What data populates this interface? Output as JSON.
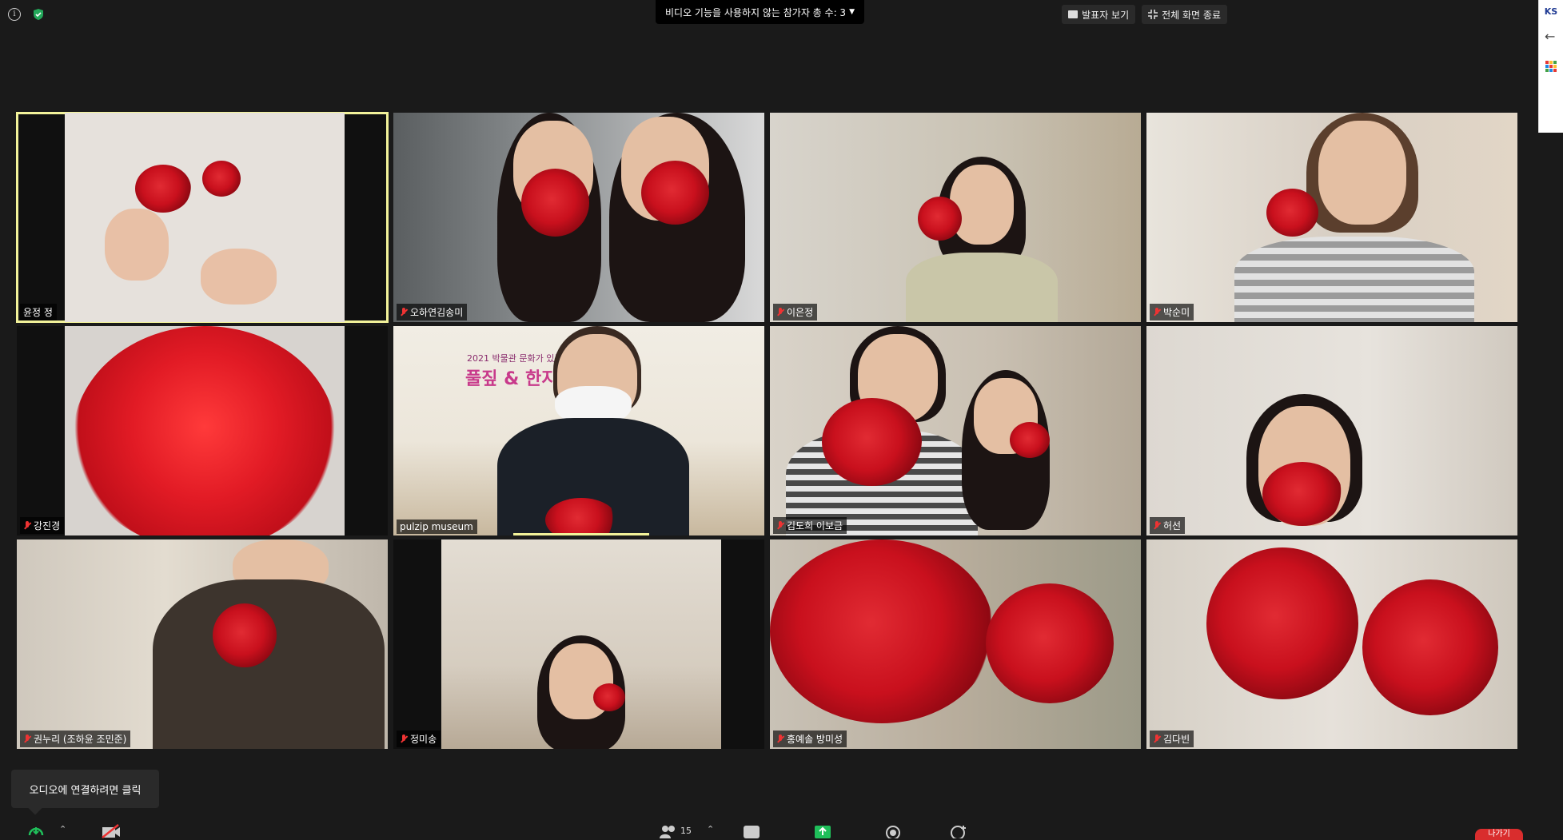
{
  "top_bar": {
    "participant_notice": "비디오 기능을 사용하지 않는 참가자 총 수: 3",
    "speaker_view_label": "발표자 보기",
    "exit_fullscreen_label": "전체 화면 종료"
  },
  "side_panel": {
    "logo_text": "KS"
  },
  "tiles": [
    {
      "name": "윤정 정",
      "muted": false,
      "active": true
    },
    {
      "name": "오하연김송미",
      "muted": true
    },
    {
      "name": "이은정",
      "muted": true
    },
    {
      "name": "박순미",
      "muted": true
    },
    {
      "name": "강진경",
      "muted": true
    },
    {
      "name": "pulzip museum",
      "muted": false,
      "speaking": true
    },
    {
      "name": "김도희 이보금",
      "muted": true
    },
    {
      "name": "허선",
      "muted": true
    },
    {
      "name": "권누리 (조하윤 조민준)",
      "muted": true
    },
    {
      "name": "정미송",
      "muted": true
    },
    {
      "name": "홍예솔 방미성",
      "muted": true
    },
    {
      "name": "김다빈",
      "muted": true
    }
  ],
  "background_banner": {
    "year_text": "2021 박물관 문화가 있는 날",
    "title_text": "풀짚 & 한지"
  },
  "tooltip": {
    "text": "오디오에 연결하려면 클릭"
  },
  "toolbar": {
    "participants_count": "15",
    "end_label": "나가기"
  },
  "colors": {
    "accent_active": "#f2f29a",
    "mute": "#e33333",
    "share_green": "#1fbf5a",
    "end_red": "#d92d2d"
  }
}
